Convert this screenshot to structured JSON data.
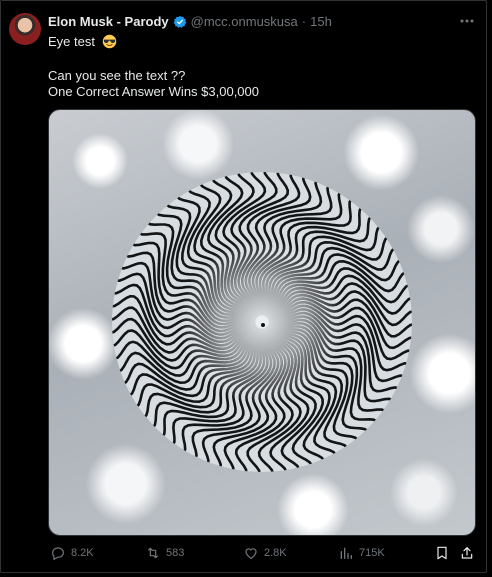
{
  "tweet": {
    "author_name": "Elon Musk - Parody",
    "handle": "@mcc.onmuskusa",
    "separator": "·",
    "time": "15h",
    "line1": "Eye test",
    "line2": "Can you see the text ??",
    "line3": "One Correct Answer Wins $3,00,000"
  },
  "actions": {
    "replies": "8.2K",
    "retweets": "583",
    "likes": "2.8K",
    "views": "715K"
  },
  "icons": [
    "verified-badge-icon",
    "more-icon",
    "sunglasses-emoji-icon",
    "reply-icon",
    "retweet-icon",
    "like-icon",
    "views-icon",
    "bookmark-icon",
    "share-icon"
  ],
  "colors": {
    "verified": "#1d9bf0",
    "muted": "#71767b",
    "text": "#e7e9ea"
  }
}
